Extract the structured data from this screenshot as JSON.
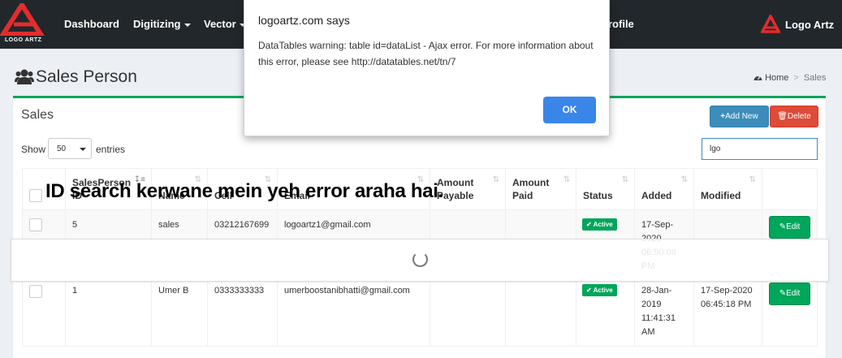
{
  "navbar": {
    "logo_text": "LOGO ARTZ",
    "items": [
      {
        "label": "Dashboard",
        "dropdown": false
      },
      {
        "label": "Digitizing",
        "dropdown": true
      },
      {
        "label": "Vector",
        "dropdown": true
      },
      {
        "label": "rofile",
        "dropdown": false
      }
    ],
    "brand_name": "Logo Artz"
  },
  "page": {
    "title": "Sales Person",
    "breadcrumb": {
      "home": "Home",
      "current": "Sales"
    }
  },
  "box": {
    "title": "Sales",
    "add_button": "Add New",
    "delete_button": "Delete"
  },
  "controls": {
    "show_label": "Show",
    "entries_value": "50",
    "entries_label": "entries",
    "search_value": "lgo"
  },
  "table": {
    "headers": [
      {
        "line1": "SalesPerson",
        "line2": "ID"
      },
      {
        "line1": "",
        "line2": "Name"
      },
      {
        "line1": "",
        "line2": "Cell"
      },
      {
        "line1": "",
        "line2": "Email"
      },
      {
        "line1": "Amount",
        "line2": "Payable"
      },
      {
        "line1": "Amount",
        "line2": "Paid"
      },
      {
        "line1": "",
        "line2": "Status"
      },
      {
        "line1": "",
        "line2": "Added"
      },
      {
        "line1": "",
        "line2": "Modified"
      }
    ],
    "rows": [
      {
        "id": "5",
        "name": "sales",
        "cell": "03212167699",
        "email": "logoartz1@gmail.com",
        "status": "Active",
        "added": "17-Sep-2020 06:50:06 PM",
        "modified": "",
        "edit": "Edit"
      },
      {
        "id": "1",
        "name": "Umer B",
        "cell": "0333333333",
        "email": "umerboostanibhatti@gmail.com",
        "status": "Active",
        "added": "28-Jan-2019 11:41:31 AM",
        "modified": "17-Sep-2020 06:45:18 PM",
        "edit": "Edit"
      }
    ]
  },
  "caption": "ID search kerwane mein yeh error araha hai.",
  "dialog": {
    "title": "logoartz.com says",
    "message": "DataTables warning: table id=dataList - Ajax error. For more information about this error, please see http://datatables.net/tn/7",
    "ok_label": "OK"
  },
  "colors": {
    "navbar": "#22272b",
    "logo_red": "#e12d2d",
    "success": "#00a65a",
    "primary": "#3c8dbc",
    "danger": "#dd4b39",
    "dialog_button": "#3a86e8"
  }
}
